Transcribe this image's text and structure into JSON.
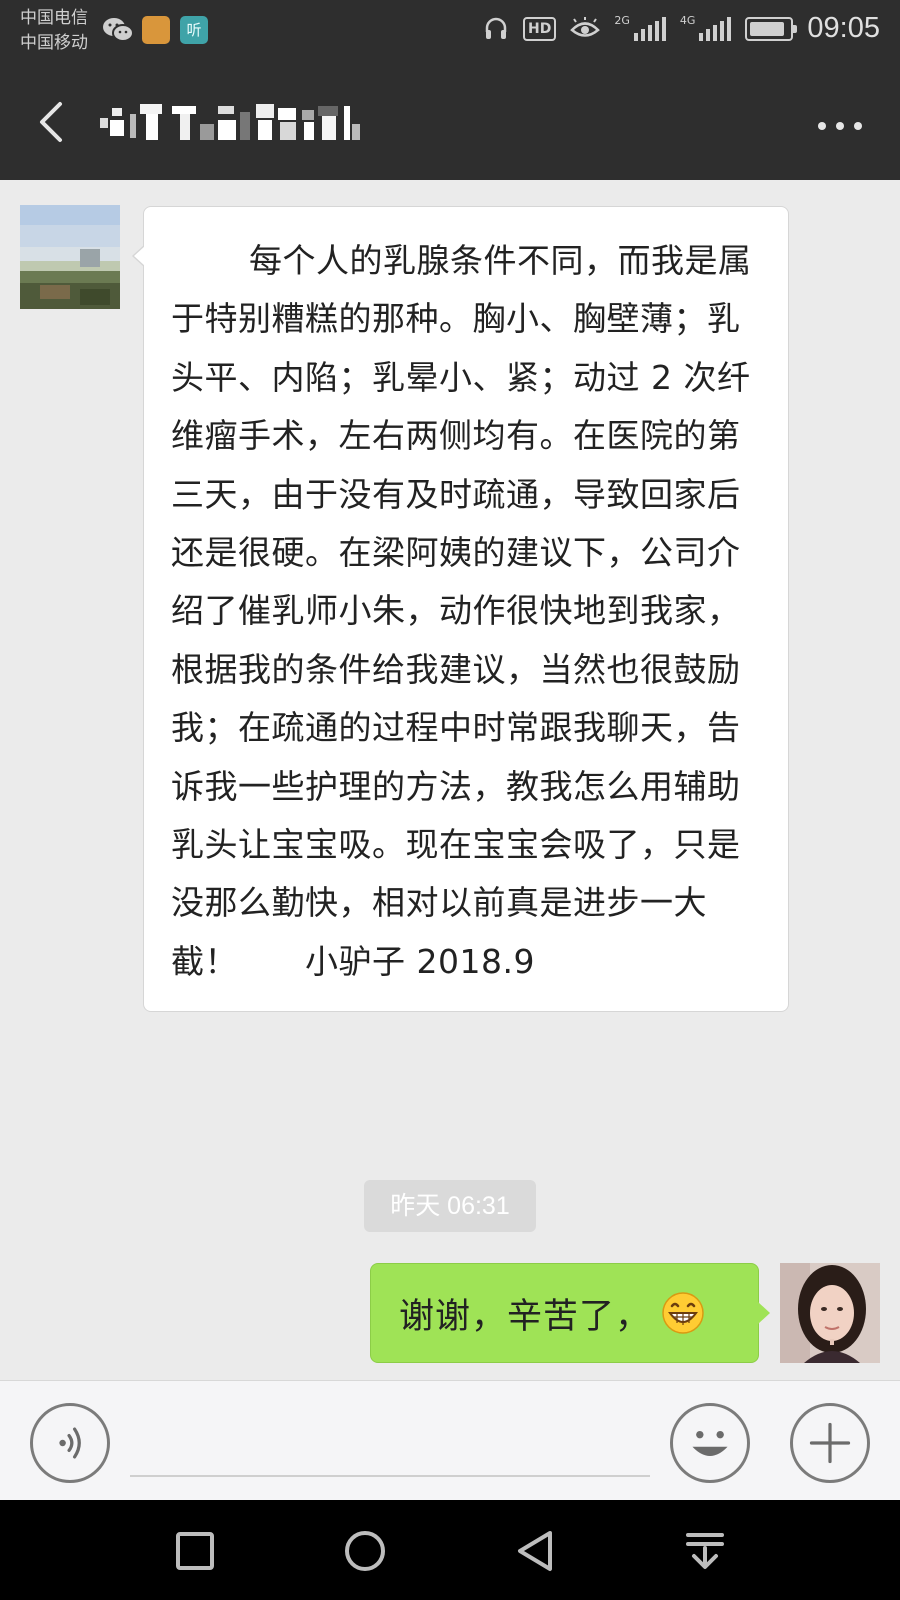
{
  "status_bar": {
    "carrier_1": "中国电信",
    "carrier_2": "中国移动",
    "app_icon_label": "听",
    "hd_label": "HD",
    "net_2g_label": "2G",
    "net_4g_label": "4G",
    "time": "09:05"
  },
  "nav": {
    "title_blurred": true
  },
  "messages": [
    {
      "side": "left",
      "text": "每个人的乳腺条件不同，而我是属于特别糟糕的那种。胸小、胸壁薄；乳头平、内陷；乳晕小、紧；动过 2 次纤维瘤手术，左右两侧均有。在医院的第三天，由于没有及时疏通，导致回家后还是很硬。在梁阿姨的建议下，公司介绍了催乳师小朱，动作很快地到我家，根据我的条件给我建议，当然也很鼓励我；在疏通的过程中时常跟我聊天，告诉我一些护理的方法，教我怎么用辅助乳头让宝宝吸。现在宝宝会吸了，只是没那么勤快，相对以前真是进步一大截！　　小驴子 2018.9"
    },
    {
      "side": "right",
      "text": "谢谢，辛苦了，",
      "emoji": "grinning-emoji"
    }
  ],
  "timestamp": "昨天 06:31",
  "input_bar": {
    "placeholder": "",
    "value": ""
  },
  "colors": {
    "header_bg": "#2e2e2e",
    "chat_bg": "#ebebeb",
    "sent_bubble": "#9fe356",
    "received_bubble": "#ffffff"
  }
}
